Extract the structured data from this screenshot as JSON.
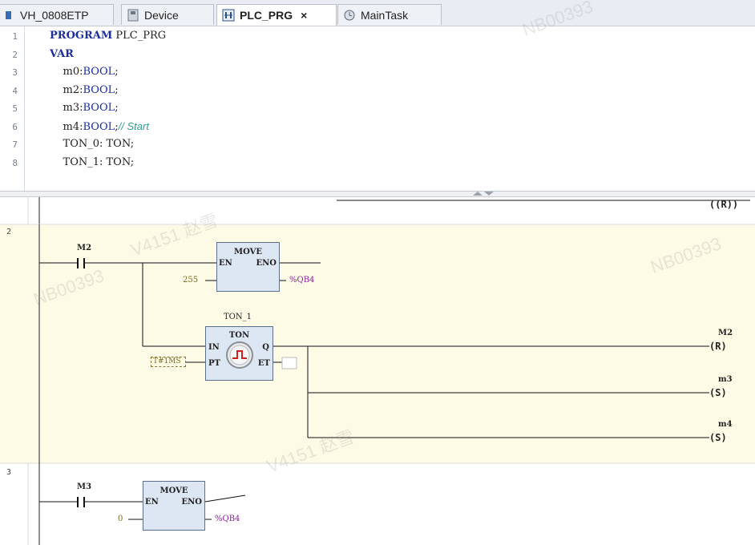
{
  "tabs": [
    {
      "label": "VH_0808ETP",
      "icon": "project-icon",
      "active": false
    },
    {
      "label": "Device",
      "icon": "device-icon",
      "active": false
    },
    {
      "label": "PLC_PRG",
      "icon": "ladder-pou-icon",
      "active": true,
      "close": "×"
    },
    {
      "label": "MainTask",
      "icon": "task-icon",
      "active": false
    }
  ],
  "editor": {
    "lines": [
      {
        "n": "1",
        "parts": [
          {
            "t": "PROGRAM",
            "c": "kw"
          },
          {
            "t": " PLC_PRG",
            "c": ""
          }
        ]
      },
      {
        "n": "2",
        "parts": [
          {
            "t": "VAR",
            "c": "kw"
          }
        ]
      },
      {
        "n": "3",
        "parts": [
          {
            "t": "    m0:",
            "c": ""
          },
          {
            "t": "BOOL",
            "c": "ty"
          },
          {
            "t": ";",
            "c": ""
          }
        ]
      },
      {
        "n": "4",
        "parts": [
          {
            "t": "    m2:",
            "c": ""
          },
          {
            "t": "BOOL",
            "c": "ty"
          },
          {
            "t": ";",
            "c": ""
          }
        ]
      },
      {
        "n": "5",
        "parts": [
          {
            "t": "    m3:",
            "c": ""
          },
          {
            "t": "BOOL",
            "c": "ty"
          },
          {
            "t": ";",
            "c": ""
          }
        ]
      },
      {
        "n": "6",
        "parts": [
          {
            "t": "    m4:",
            "c": ""
          },
          {
            "t": "BOOL",
            "c": "ty"
          },
          {
            "t": ";",
            "c": ""
          },
          {
            "t": "// Start",
            "c": "cm"
          }
        ]
      },
      {
        "n": "7",
        "parts": [
          {
            "t": "    TON_0: TON;",
            "c": ""
          }
        ]
      },
      {
        "n": "8",
        "parts": [
          {
            "t": "    TON_1: TON;",
            "c": ""
          }
        ]
      }
    ]
  },
  "ladder": {
    "network2": {
      "number": "2",
      "contact_m2": "M2",
      "move_block": {
        "title": "MOVE",
        "en": "EN",
        "eno": "ENO",
        "input": "255",
        "output": "%QB4"
      },
      "ton_instance": "TON_1",
      "ton_block": {
        "title": "TON",
        "in": "IN",
        "pt": "PT",
        "q": "Q",
        "et": "ET",
        "pt_value": "T#1MS"
      },
      "coils": [
        {
          "name": "M2",
          "type": "R"
        },
        {
          "name": "m3",
          "type": "S"
        },
        {
          "name": "m4",
          "type": "S"
        }
      ]
    },
    "network3": {
      "number": "3",
      "contact_m3": "M3",
      "move_block": {
        "title": "MOVE",
        "en": "EN",
        "eno": "ENO",
        "input": "0",
        "output": "%QB4"
      }
    },
    "top_coil_partial": "R"
  },
  "watermark": {
    "text_a": "NB00393",
    "text_b": "V4151 赵雪"
  },
  "colors": {
    "network_bg": "#fdfbe6",
    "fb_fill": "#dde6f3",
    "keyword": "#1c2d9c",
    "comment": "#2f9e8f",
    "address": "#8b1f9b"
  }
}
